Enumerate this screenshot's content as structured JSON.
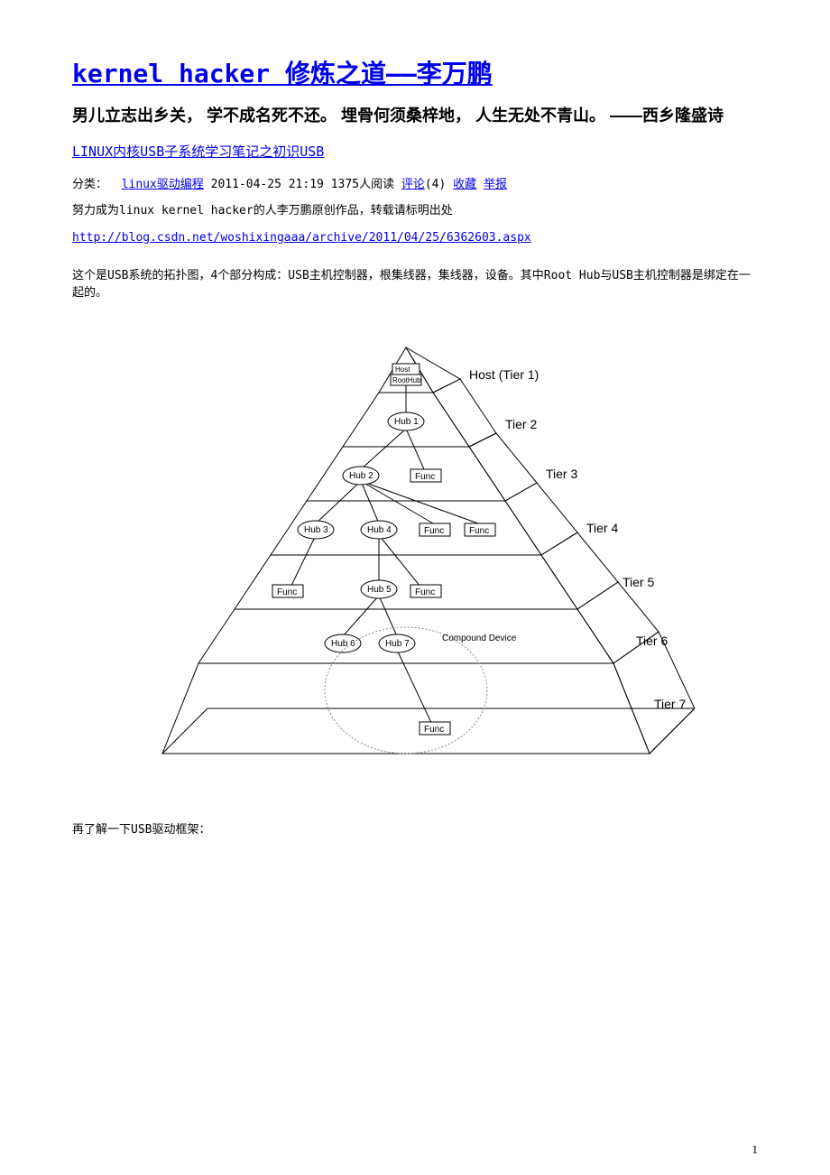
{
  "header": {
    "main_title": "kernel hacker 修炼之道——李万鹏",
    "subtitle": "男儿立志出乡关， 学不成名死不还。 埋骨何须桑梓地， 人生无处不青山。 ——西乡隆盛诗",
    "article_title": "LINUX内核USB子系统学习笔记之初识USB"
  },
  "meta": {
    "category_label": "分类：",
    "category_link": "linux驱动编程",
    "timestamp": "2011-04-25 21:19",
    "reads": "1375人阅读",
    "comments_label": "评论",
    "comments_count": "(4)",
    "favorite": "收藏",
    "report": "举报"
  },
  "body": {
    "author_note": "努力成为linux kernel hacker的人李万鹏原创作品，转载请标明出处",
    "source_url": "http://blog.csdn.net/woshixingaaa/archive/2011/04/25/6362603.aspx",
    "intro": "这个是USB系统的拓扑图，4个部分构成：USB主机控制器，根集线器，集线器，设备。其中Root Hub与USB主机控制器是绑定在一起的。",
    "outro": "再了解一下USB驱动框架："
  },
  "diagram": {
    "tiers": {
      "t1": "Host (Tier 1)",
      "t2": "Tier 2",
      "t3": "Tier 3",
      "t4": "Tier 4",
      "t5": "Tier 5",
      "t6": "Tier 6",
      "t7": "Tier 7"
    },
    "nodes": {
      "host": "Host",
      "roothub": "RootHub",
      "hub1": "Hub 1",
      "hub2": "Hub 2",
      "hub3": "Hub 3",
      "hub4": "Hub 4",
      "hub5": "Hub 5",
      "hub6": "Hub 6",
      "hub7": "Hub 7",
      "func": "Func",
      "compound": "Compound Device"
    }
  },
  "page_number": "1"
}
